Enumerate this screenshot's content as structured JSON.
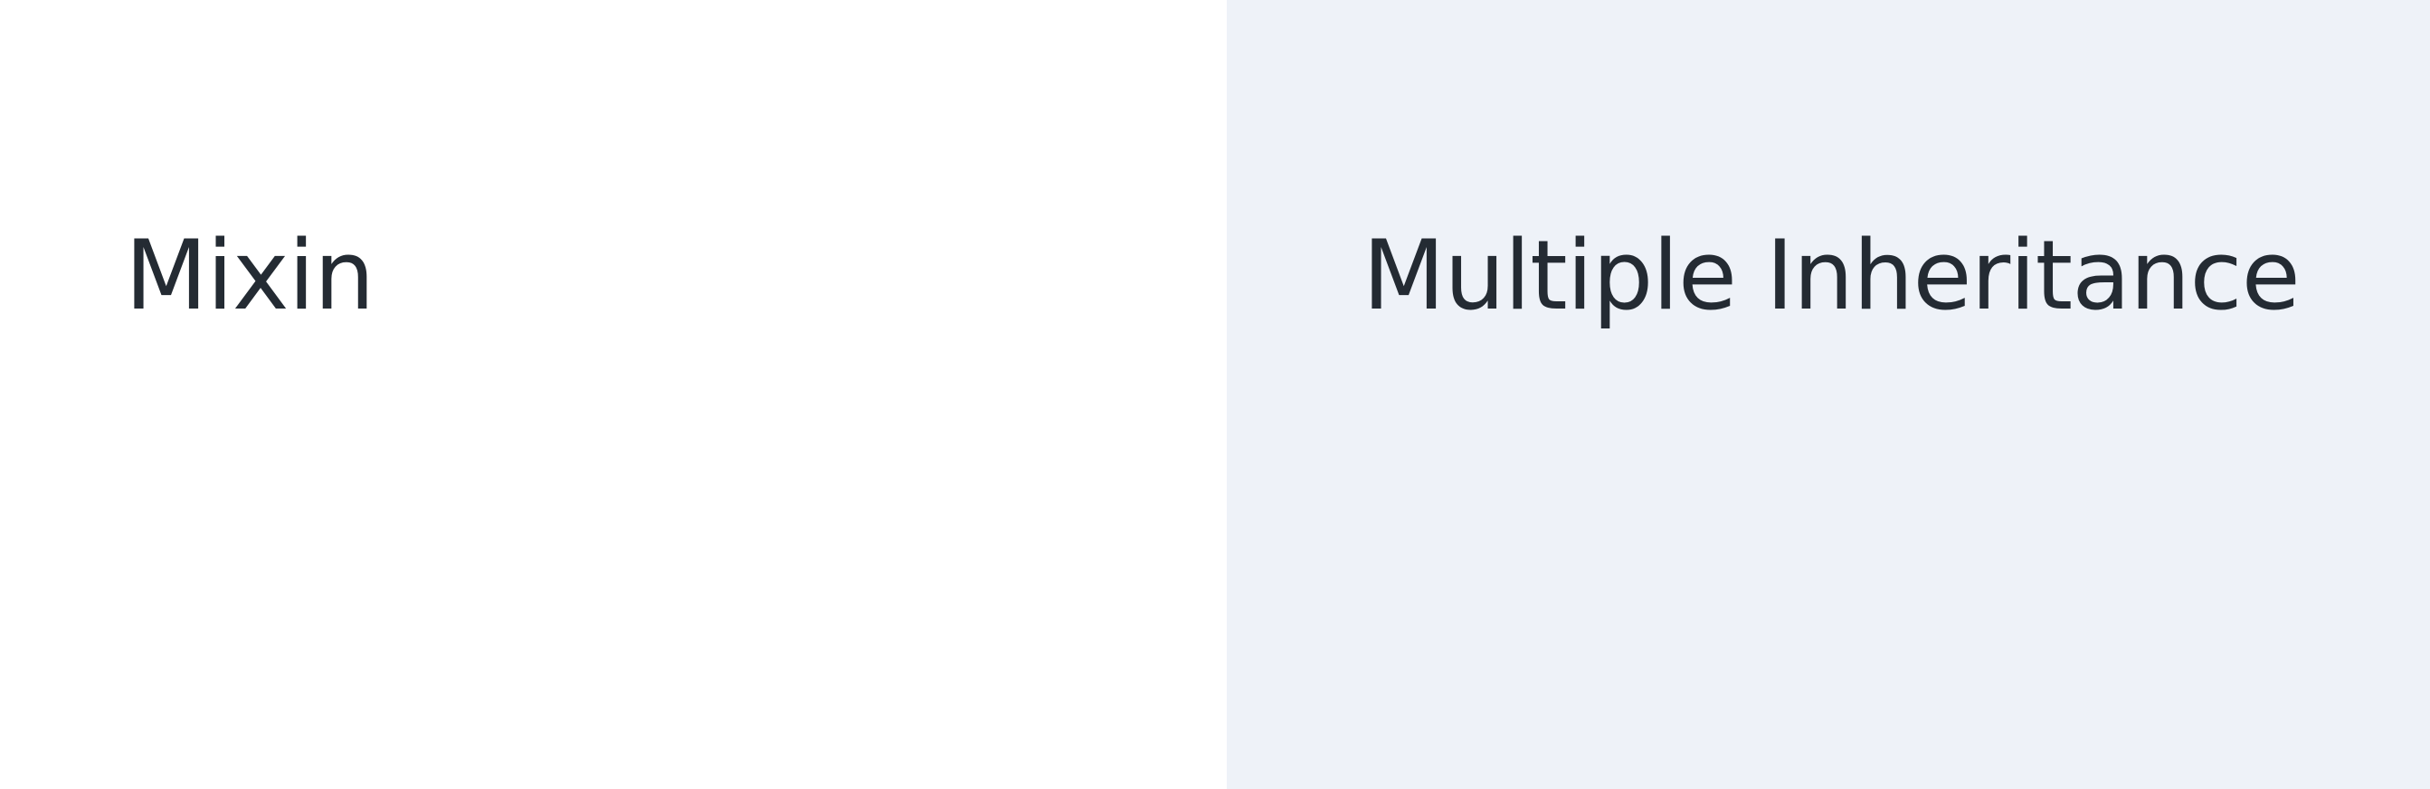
{
  "left_panel": {
    "title": "Mixin"
  },
  "right_panel": {
    "title": "Multiple Inheritance"
  },
  "colors": {
    "left_background": "#ffffff",
    "right_background": "#eef2f8",
    "text": "#242b33"
  }
}
